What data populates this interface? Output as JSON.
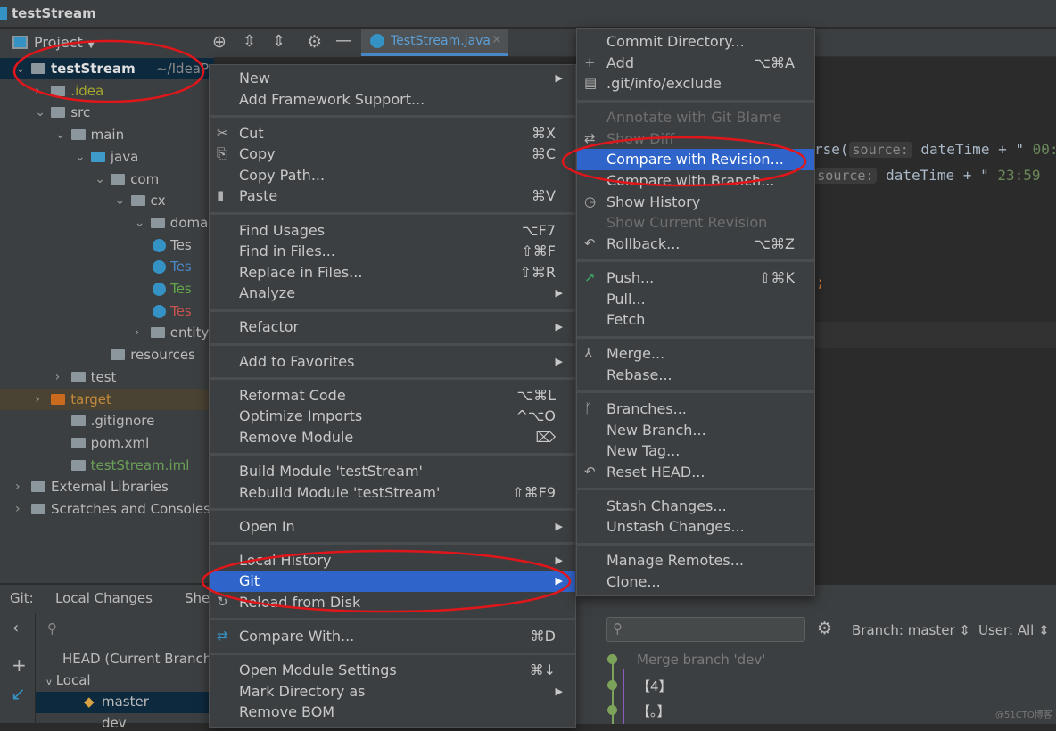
{
  "window": {
    "title": "testStream"
  },
  "project_header": {
    "label": "Project",
    "tool_icons": [
      "locate-icon",
      "expand-all-icon",
      "collapse-all-icon",
      "gear-icon",
      "minimize-icon"
    ]
  },
  "editor": {
    "tab": "TestStream.java",
    "lines": [
      {
        "pre": "rse(",
        "hint": "source:",
        "code": " dateTime + \"",
        "str": " 00:"
      },
      {
        "pre": "e(",
        "hint": "source:",
        "code": " dateTime + \"",
        "str": " 23:59"
      }
    ],
    "semicolon": ";"
  },
  "tree": [
    {
      "label": "testStream",
      "extra": "~/IdeaPro",
      "arrow": "v",
      "depth": 0,
      "sel": true,
      "bold": true
    },
    {
      "label": ".idea",
      "arrow": ">",
      "depth": 1,
      "color": "#a8a830"
    },
    {
      "label": "src",
      "arrow": "v",
      "depth": 1
    },
    {
      "label": "main",
      "arrow": "v",
      "depth": 2
    },
    {
      "label": "java",
      "arrow": "v",
      "depth": 3,
      "icon": "#3d9ac9"
    },
    {
      "label": "com",
      "arrow": "v",
      "depth": 4
    },
    {
      "label": "cx",
      "arrow": "v",
      "depth": 5
    },
    {
      "label": "doma",
      "arrow": "v",
      "depth": 6
    },
    {
      "label": "Tes",
      "depth": 7,
      "cls": true
    },
    {
      "label": "Tes",
      "depth": 7,
      "cls": true,
      "color": "#4a88c7"
    },
    {
      "label": "Tes",
      "depth": 7,
      "cls": true,
      "color": "#62a84a"
    },
    {
      "label": "Tes",
      "depth": 7,
      "cls": true,
      "color": "#c75450"
    },
    {
      "label": "entity",
      "arrow": ">",
      "depth": 6
    },
    {
      "label": "resources",
      "depth": 4
    },
    {
      "label": "test",
      "arrow": ">",
      "depth": 2
    },
    {
      "label": "target",
      "arrow": ">",
      "depth": 1,
      "color": "#c18a3a",
      "tgt": true,
      "icon": "#c96a1e"
    },
    {
      "label": ".gitignore",
      "depth": 2
    },
    {
      "label": "pom.xml",
      "depth": 2
    },
    {
      "label": "testStream.iml",
      "depth": 2,
      "color": "#6a9f58"
    },
    {
      "label": "External Libraries",
      "arrow": ">",
      "depth": 0
    },
    {
      "label": "Scratches and Consoles",
      "arrow": ">",
      "depth": 0
    }
  ],
  "context_menu": [
    {
      "label": "New",
      "sub": true
    },
    {
      "label": "Add Framework Support..."
    },
    {
      "sep": true
    },
    {
      "label": "Cut",
      "sc": "⌘X",
      "icon": "✂"
    },
    {
      "label": "Copy",
      "sc": "⌘C",
      "icon": "⎘"
    },
    {
      "label": "Copy Path..."
    },
    {
      "label": "Paste",
      "sc": "⌘V",
      "icon": "▮"
    },
    {
      "sep": true
    },
    {
      "label": "Find Usages",
      "sc": "⌥F7"
    },
    {
      "label": "Find in Files...",
      "sc": "⇧⌘F"
    },
    {
      "label": "Replace in Files...",
      "sc": "⇧⌘R"
    },
    {
      "label": "Analyze",
      "sub": true
    },
    {
      "sep": true
    },
    {
      "label": "Refactor",
      "sub": true
    },
    {
      "sep": true
    },
    {
      "label": "Add to Favorites",
      "sub": true
    },
    {
      "sep": true
    },
    {
      "label": "Reformat Code",
      "sc": "⌥⌘L"
    },
    {
      "label": "Optimize Imports",
      "sc": "^⌥O"
    },
    {
      "label": "Remove Module",
      "sc": "⌦"
    },
    {
      "sep": true
    },
    {
      "label": "Build Module 'testStream'"
    },
    {
      "label": "Rebuild Module 'testStream'",
      "sc": "⇧⌘F9"
    },
    {
      "sep": true
    },
    {
      "label": "Open In",
      "sub": true
    },
    {
      "sep": true
    },
    {
      "label": "Local History",
      "sub": true
    },
    {
      "label": "Git",
      "sub": true,
      "hl": true
    },
    {
      "label": "Reload from Disk",
      "icon": "↻"
    },
    {
      "sep": true
    },
    {
      "label": "Compare With...",
      "sc": "⌘D",
      "icon": "⇄"
    },
    {
      "sep": true
    },
    {
      "label": "Open Module Settings",
      "sc": "⌘↓"
    },
    {
      "label": "Mark Directory as",
      "sub": true
    },
    {
      "label": "Remove BOM"
    }
  ],
  "git_menu": [
    {
      "label": "Commit Directory..."
    },
    {
      "label": "Add",
      "sc": "⌥⌘A",
      "icon": "+"
    },
    {
      "label": ".git/info/exclude",
      "icon": "▤"
    },
    {
      "sep": true
    },
    {
      "label": "Annotate with Git Blame",
      "dis": true
    },
    {
      "label": "Show Diff",
      "dis": true,
      "icon": "⇄"
    },
    {
      "label": "Compare with Revision...",
      "hl": true
    },
    {
      "label": "Compare with Branch..."
    },
    {
      "label": "Show History",
      "icon": "◷"
    },
    {
      "label": "Show Current Revision",
      "dis": true
    },
    {
      "label": "Rollback...",
      "sc": "⌥⌘Z",
      "icon": "↶"
    },
    {
      "sep": true
    },
    {
      "label": "Push...",
      "sc": "⇧⌘K",
      "icon": "↗"
    },
    {
      "label": "Pull..."
    },
    {
      "label": "Fetch"
    },
    {
      "sep": true
    },
    {
      "label": "Merge...",
      "icon": "⅄"
    },
    {
      "label": "Rebase..."
    },
    {
      "sep": true
    },
    {
      "label": "Branches...",
      "icon": "ᚴ"
    },
    {
      "label": "New Branch..."
    },
    {
      "label": "New Tag..."
    },
    {
      "label": "Reset HEAD...",
      "icon": "↶"
    },
    {
      "sep": true
    },
    {
      "label": "Stash Changes..."
    },
    {
      "label": "Unstash Changes..."
    },
    {
      "sep": true
    },
    {
      "label": "Manage Remotes..."
    },
    {
      "label": "Clone..."
    }
  ],
  "git_panel": {
    "title": "Git:",
    "tabs": [
      "Local Changes",
      "She"
    ],
    "branches": {
      "head": "HEAD (Current Branch)",
      "local": "Local",
      "master": "master",
      "dev": "dev"
    },
    "branch_filter": "Branch: master",
    "user_filter": "User: All",
    "commits": [
      "Merge branch 'dev'",
      "【4】",
      "【。】"
    ],
    "watermark": "@51CTO博客"
  },
  "colors": {
    "highlight": "#2f65ca",
    "annotation": "#e0161b"
  }
}
